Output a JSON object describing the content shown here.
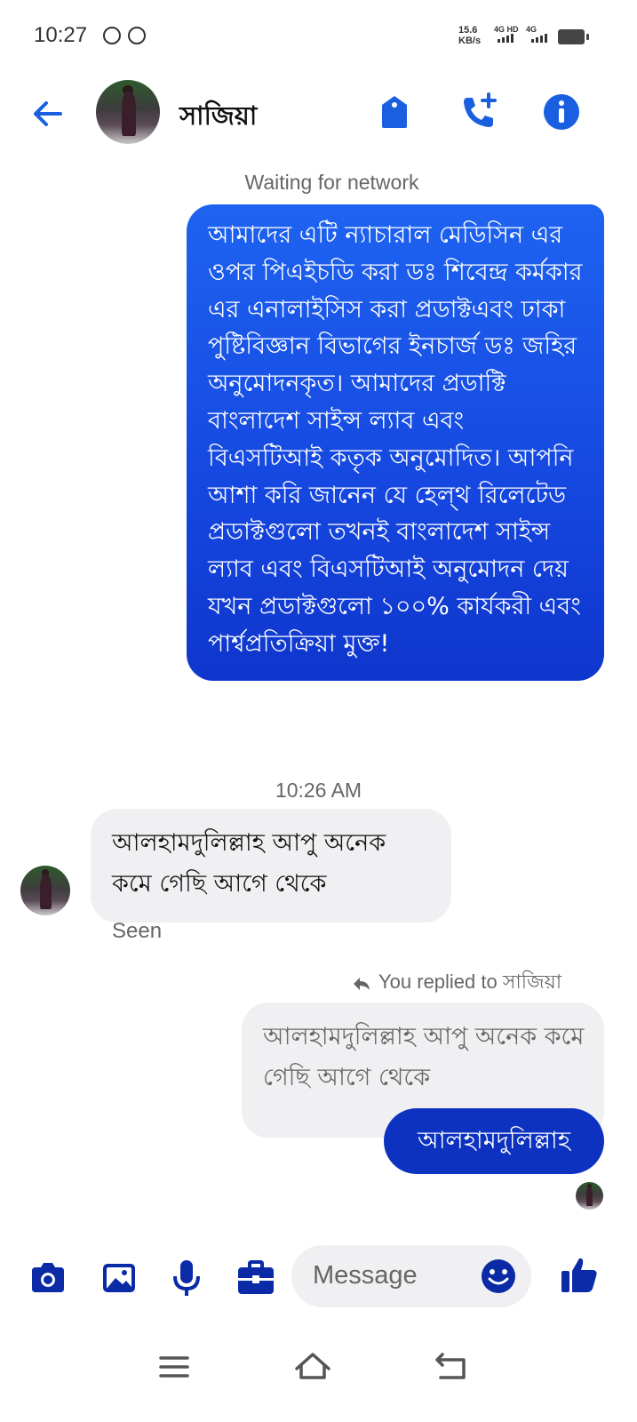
{
  "status_bar": {
    "time": "10:27",
    "speed_value": "15.6",
    "speed_unit": "KB/s",
    "network_1": "4G HD",
    "network_2": "4G"
  },
  "header": {
    "contact_name": "সাজিয়া",
    "back_icon": "arrow-left-icon",
    "actions": [
      "tag-icon",
      "add-call-icon",
      "info-icon"
    ],
    "accent_color": "#1a5fe0"
  },
  "chat": {
    "network_status": "Waiting for network",
    "outgoing_message": "আমাদের এটি ন্যাচারাল মেডিসিন এর ওপর পিএইচডি করা ডঃ শিবেন্দ্র কর্মকার  এর এনালাইসিস করা প্রডাক্টএবং ঢাকা পুষ্টিবিজ্ঞান বিভাগের ইনচার্জ ডঃ জহির অনুমোদনকৃত। আমাদের প্রডাক্টি বাংলাদেশ সাইন্স ল্যাব এবং বিএসটিআই কতৃক অনুমোদিত। আপনি আশা করি জানেন যে হেল্থ রিলেটেড প্রডাক্টগুলো তখনই বাংলাদেশ সাইন্স ল্যাব এবং বিএসটিআই অনুমোদন দেয় যখন প্রডাক্টগুলো ১০০% কার্যকরী এবং পার্শ্বপ্রতিক্রিয়া মুক্ত!",
    "timestamp": "10:26 AM",
    "incoming_message": "আলহামদুলিল্লাহ আপু অনেক কমে গেছি আগে থেকে",
    "seen_label": "Seen",
    "replied_label": "You replied to সাজিয়া",
    "quoted_message": "আলহামদুলিল্লাহ আপু অনেক কমে গেছি আগে থেকে",
    "reply_message": "আলহামদুলিল্লাহ"
  },
  "composer": {
    "placeholder": "Message",
    "icons": [
      "camera-icon",
      "gallery-icon",
      "microphone-icon",
      "briefcase-icon",
      "emoji-icon",
      "thumbs-up-icon"
    ],
    "icon_color": "#0a2aa6"
  },
  "nav_bar": {
    "icons": [
      "menu-icon",
      "home-icon",
      "back-nav-icon"
    ]
  }
}
